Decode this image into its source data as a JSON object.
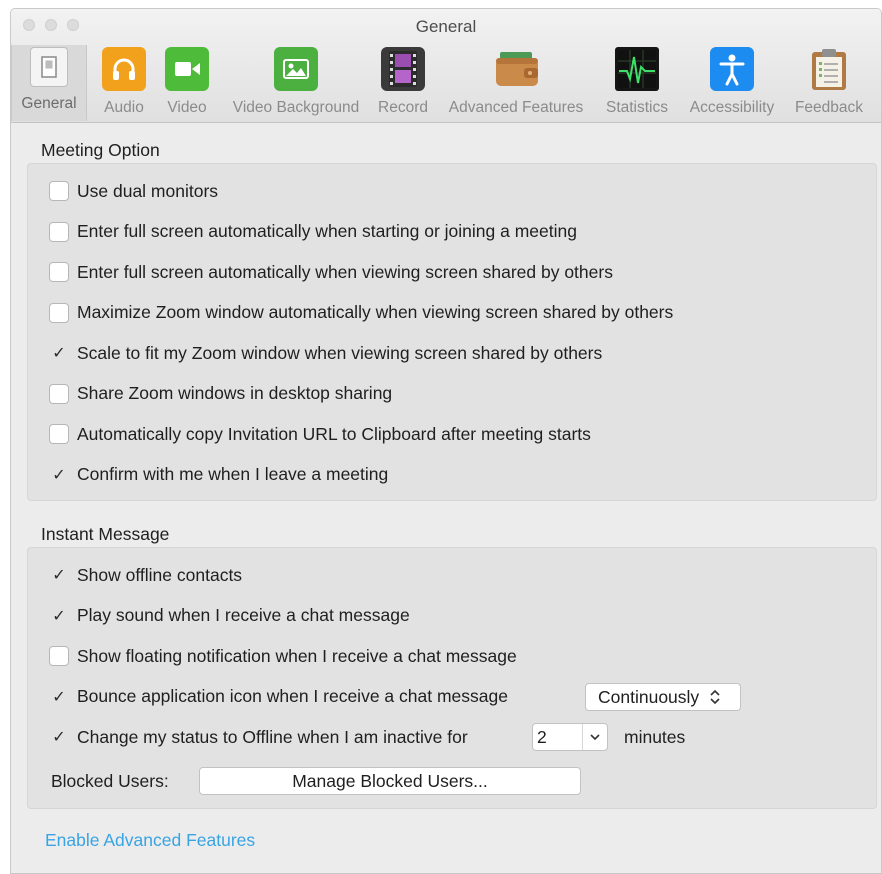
{
  "window": {
    "title": "General"
  },
  "tabs": [
    {
      "label": "General",
      "icon": "general-switch-icon",
      "selected": true
    },
    {
      "label": "Audio",
      "icon": "headphones-icon",
      "color": "#f0a020"
    },
    {
      "label": "Video",
      "icon": "video-camera-icon",
      "color": "#5cb93a"
    },
    {
      "label": "Video Background",
      "icon": "image-icon",
      "color": "#4fb145"
    },
    {
      "label": "Record",
      "icon": "film-strip-icon",
      "color": "#5d3d6b"
    },
    {
      "label": "Advanced Features",
      "icon": "wallet-icon",
      "color": "#c98a4a"
    },
    {
      "label": "Statistics",
      "icon": "activity-monitor-icon",
      "color": "#1a1a1a"
    },
    {
      "label": "Accessibility",
      "icon": "accessibility-icon",
      "color": "#1d8cf0"
    },
    {
      "label": "Feedback",
      "icon": "clipboard-icon",
      "color": "#b07a45"
    }
  ],
  "meeting": {
    "title": "Meeting Option",
    "options": [
      {
        "label": "Use dual monitors",
        "checked": false
      },
      {
        "label": "Enter full screen automatically when starting or joining a meeting",
        "checked": false
      },
      {
        "label": "Enter full screen automatically when viewing screen shared by others",
        "checked": false
      },
      {
        "label": "Maximize Zoom window automatically when viewing screen shared by others",
        "checked": false
      },
      {
        "label": "Scale to fit my Zoom window when viewing screen shared by others",
        "checked": true
      },
      {
        "label": "Share Zoom windows in desktop sharing",
        "checked": false
      },
      {
        "label": "Automatically copy Invitation URL to Clipboard after meeting starts",
        "checked": false
      },
      {
        "label": "Confirm with me when I leave a meeting",
        "checked": true
      }
    ]
  },
  "im": {
    "title": "Instant Message",
    "options": [
      {
        "label": "Show offline contacts",
        "checked": true
      },
      {
        "label": "Play sound when I receive a chat message",
        "checked": true
      },
      {
        "label": "Show floating notification when I receive a chat message",
        "checked": false
      },
      {
        "label": "Bounce application icon when I receive a chat message",
        "checked": true
      },
      {
        "label": "Change my status to Offline when I am inactive for",
        "checked": true
      }
    ],
    "bounce_select": "Continuously",
    "inactive_select": "2",
    "minutes_label": "minutes",
    "blocked_label": "Blocked Users:",
    "manage_button": "Manage Blocked Users..."
  },
  "footer": {
    "advanced_link": "Enable Advanced Features"
  },
  "check_glyph": "✓"
}
